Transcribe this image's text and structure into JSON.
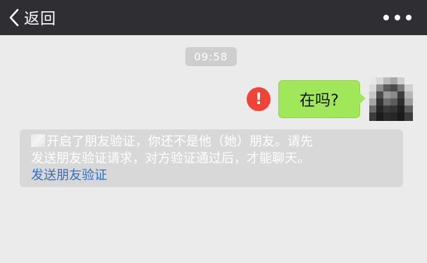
{
  "header": {
    "back_label": "返回",
    "more_icon": "more-dots-icon",
    "back_icon": "chevron-left-icon"
  },
  "chat": {
    "timestamp": "09:58",
    "message": {
      "text": "在吗?",
      "status_icon": "exclamation-error-icon",
      "status_symbol": "!",
      "bubble_color": "#a0e75a",
      "error_color": "#f04438"
    },
    "system_notice": {
      "line1": "开启了朋友验证，你还不是他（她）朋友。请先",
      "line2": "发送朋友验证请求，对方验证通过后，才能聊天。",
      "link_text": "发送朋友验证",
      "link_color": "#2f6fc4"
    }
  },
  "colors": {
    "titlebar": "#2e2e33",
    "background": "#ebebeb"
  }
}
